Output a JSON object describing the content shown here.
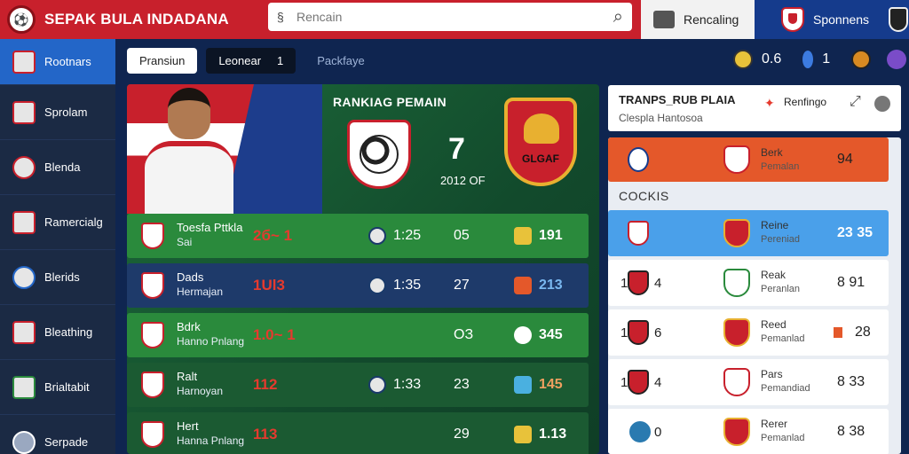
{
  "header": {
    "brand": "SEPAK BULA INDADANA",
    "search_placeholder": "Rencain",
    "ranking_tab": "Rencaling",
    "user_tab": "Sponnens"
  },
  "sidebar": {
    "items": [
      {
        "label": "Rootnars",
        "icon": "shield-icon"
      },
      {
        "label": "Sprolam",
        "icon": "whistle-icon"
      },
      {
        "label": "Blenda",
        "icon": "trophy-icon"
      },
      {
        "label": "Ramercialg",
        "icon": "calendar-icon"
      },
      {
        "label": "Blerids",
        "icon": "globe-icon"
      },
      {
        "label": "Bleathing",
        "icon": "medal-icon"
      },
      {
        "label": "Brialtabit",
        "icon": "shield-green-icon"
      },
      {
        "label": "Serpade",
        "icon": "user-icon"
      }
    ]
  },
  "tabs": {
    "first": "Pransiun",
    "second": "Leonear",
    "second_count": "1",
    "third": "Packfaye"
  },
  "stats": {
    "score": "0.6",
    "count": "1"
  },
  "hero": {
    "title": "RANKIAG PEMAIN",
    "score": "7",
    "sub": "2012 OF",
    "crest_text": "GLGAF"
  },
  "matches": [
    {
      "name": "Toesfa Pttkla",
      "sub": "Sai",
      "score": "2б~ 1",
      "time": "1:25",
      "num": "05",
      "pts": "191"
    },
    {
      "name": "Dads",
      "sub": "Hermajan",
      "score": "1Ul3",
      "time": "1:35",
      "num": "27",
      "pts": "213"
    },
    {
      "name": "Bdrk",
      "sub": "Hanno Pnlang",
      "score": "1.0~ 1",
      "time": "",
      "num": "ОЗ",
      "pts": "345"
    },
    {
      "name": "Ralt",
      "sub": "Harnoyan",
      "score": "112",
      "time": "1:33",
      "num": "23",
      "pts": "145"
    },
    {
      "name": "Hert",
      "sub": "Hanna Pnlang",
      "score": "113",
      "time": "",
      "num": "29",
      "pts": "1.13"
    }
  ],
  "right_panel": {
    "title": "TRANPS_RUB PLAIA",
    "subtitle": "Clespla Hantosoa",
    "trend_label": "Renfingo",
    "section": "COCKIS",
    "top_row": {
      "name": "Berk",
      "sub": "Pemalan",
      "pts": "94"
    },
    "rows": [
      {
        "rank": "",
        "num": "",
        "name": "Reine",
        "sub": "Pereniad",
        "pts": "23 35"
      },
      {
        "rank": "1",
        "num": "4",
        "name": "Reak",
        "sub": "Peranlan",
        "pts": "8 91"
      },
      {
        "rank": "1",
        "num": "6",
        "name": "Reed",
        "sub": "Pemanlad",
        "pts": "28"
      },
      {
        "rank": "1",
        "num": "4",
        "name": "Pars",
        "sub": "Pemandiad",
        "pts": "8 33"
      },
      {
        "rank": "",
        "num": "0",
        "name": "Rerer",
        "sub": "Pemanlad",
        "pts": "8 38"
      }
    ]
  },
  "colors": {
    "primary_red": "#c8202c",
    "primary_blue": "#153b8c",
    "active_blue": "#2366c8",
    "green": "#2a8a3c"
  }
}
